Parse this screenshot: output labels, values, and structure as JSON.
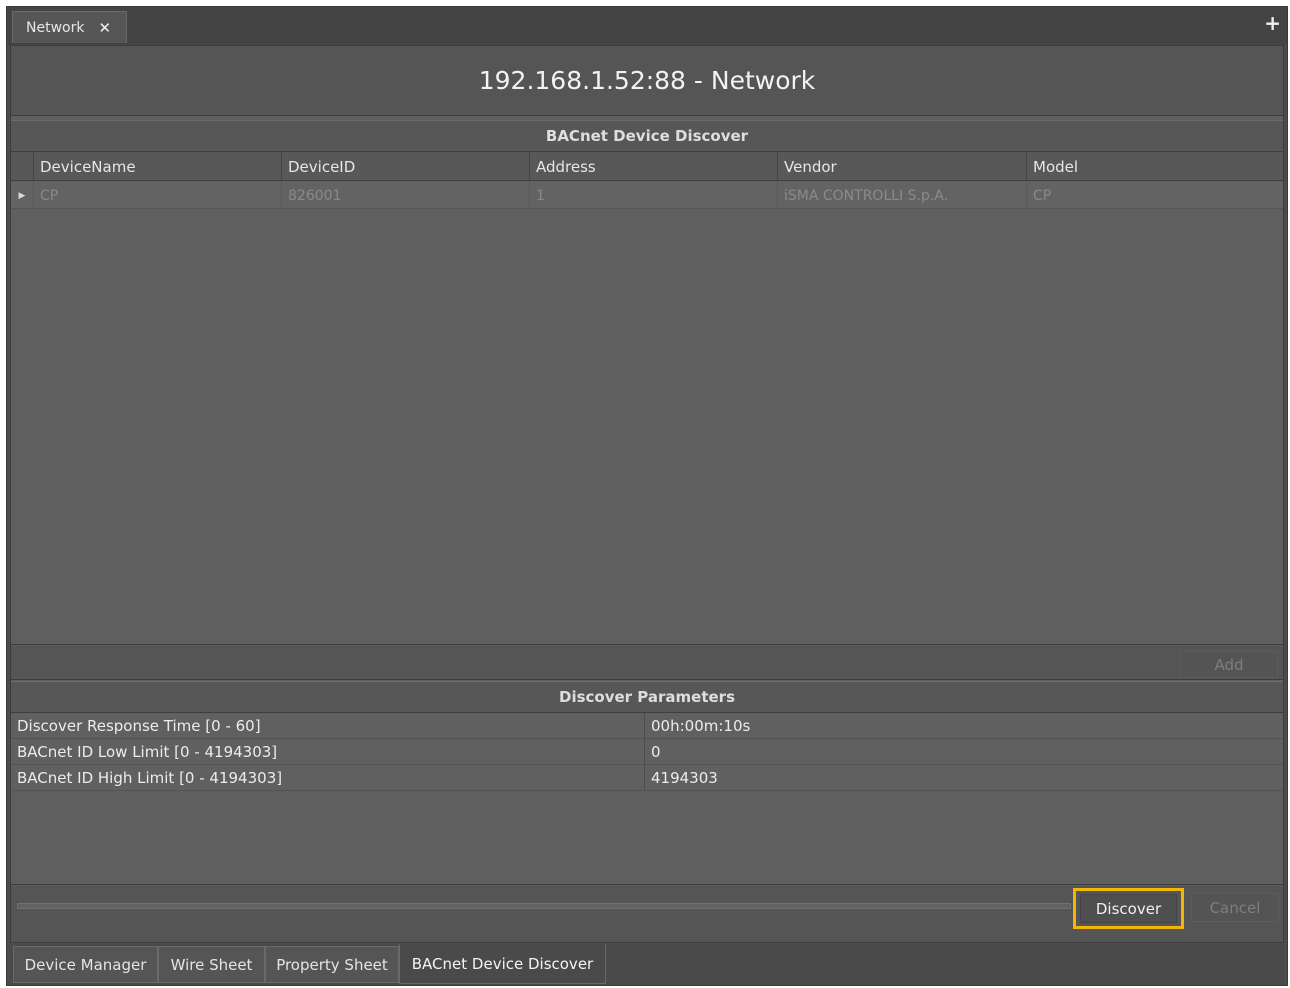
{
  "tab": {
    "label": "Network",
    "close_glyph": "✕"
  },
  "add_tab_glyph": "+",
  "header": {
    "title": "192.168.1.52:88 - Network"
  },
  "discover": {
    "section_title": "BACnet Device Discover",
    "columns": [
      "DeviceName",
      "DeviceID",
      "Address",
      "Vendor",
      "Model"
    ],
    "rows": [
      {
        "indicator": "▶",
        "cells": [
          "CP",
          "826001",
          "1",
          "iSMA CONTROLLI S.p.A.",
          "CP"
        ]
      }
    ],
    "add_label": "Add"
  },
  "params": {
    "section_title": "Discover Parameters",
    "rows": [
      {
        "label": "Discover Response Time [0 - 60]",
        "value": "00h:00m:10s"
      },
      {
        "label": "BACnet ID Low Limit [0 - 4194303]",
        "value": "0"
      },
      {
        "label": "BACnet ID High Limit [0 - 4194303]",
        "value": "4194303"
      }
    ]
  },
  "actions": {
    "discover_label": "Discover",
    "cancel_label": "Cancel",
    "highlight_color": "#f2b705"
  },
  "view_tabs": [
    "Device Manager",
    "Wire Sheet",
    "Property Sheet",
    "BACnet Device Discover"
  ],
  "active_view_tab": "BACnet Device Discover"
}
